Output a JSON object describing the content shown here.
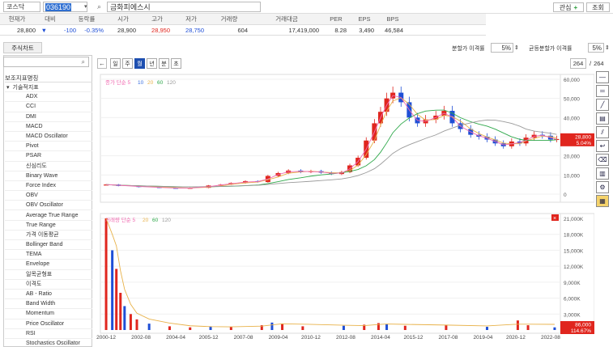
{
  "header": {
    "market": "코스닥",
    "code": "036190",
    "name": "금화피에스시",
    "interest": "관심",
    "query": "조회"
  },
  "quote_cols": [
    "현재가",
    "대비",
    "등락률",
    "시가",
    "고가",
    "저가",
    "거래량",
    "거래대금",
    "PER",
    "EPS",
    "BPS"
  ],
  "quote": {
    "price": "28,800",
    "arrow": "▼",
    "change": "-100",
    "rate": "-0.35%",
    "open": "28,900",
    "high": "28,950",
    "low": "28,750",
    "volume": "604",
    "amount": "17,419,000",
    "per": "8.28",
    "eps": "3,490",
    "bps": "46,584"
  },
  "tab": "주식차트",
  "split": {
    "label1": "분할가 이격률",
    "val1": "5%",
    "label2": "균등분할가 이격률",
    "val2": "5%"
  },
  "periods": [
    "일",
    "주",
    "월",
    "년",
    "분",
    "초"
  ],
  "active_period": "월",
  "count": {
    "shown": "264",
    "total": "264"
  },
  "left": {
    "title": "보조지표명칭",
    "group": "기술적지표",
    "items": [
      "ADX",
      "CCI",
      "DMI",
      "MACD",
      "MACD Oscillator",
      "Pivot",
      "PSAR",
      "신심리도",
      "Binary Wave",
      "Force Index",
      "OBV",
      "OBV Oscillator",
      "Average True Range",
      "True Range",
      "가격 이동평균",
      "Bollinger Band",
      "TEMA",
      "Envelope",
      "일목균형표",
      "이격도",
      "AB - Ratio",
      "Band Width",
      "Momentum",
      "Price Oscillator",
      "RSI",
      "Stochastics Oscillator"
    ]
  },
  "legend_price": {
    "label": "종가 단순",
    "p1": "5",
    "p2": "10",
    "p3": "20",
    "p4": "60",
    "p5": "120"
  },
  "legend_vol": {
    "label": "거래량 단순",
    "p1": "5",
    "p2": "20",
    "p3": "60",
    "p4": "120"
  },
  "price_badge": {
    "v": "28,800",
    "p": "5.04%"
  },
  "vol_badge": {
    "v": "86,000",
    "p": "114.67%"
  },
  "colors": {
    "ma5": "#f06ab0",
    "ma10": "#3a6fe0",
    "ma20": "#e8b24a",
    "ma60": "#2ea84a",
    "ma120": "#9a9a9a",
    "up": "#e0261e",
    "down": "#1f4fd6",
    "badge": "#e0261e"
  },
  "chart_data": [
    {
      "type": "candlestick",
      "title": "",
      "ylim": [
        0,
        60000
      ],
      "y_ticks": [
        "60,000",
        "50,000",
        "40,000",
        "30,000",
        "20,000",
        "10,000",
        "0"
      ],
      "x_ticks": [
        "2000-12",
        "2002-08",
        "2004-04",
        "2005-12",
        "2007-08",
        "2009-04",
        "2010-12",
        "2012-08",
        "2014-04",
        "2015-12",
        "2017-08",
        "2019-04",
        "2020-12",
        "2022-08"
      ],
      "x": [
        2000.9,
        2001.5,
        2002.5,
        2003.5,
        2004.3,
        2005.0,
        2005.9,
        2006.5,
        2007.0,
        2007.7,
        2008.3,
        2008.8,
        2009.3,
        2009.8,
        2010.4,
        2010.9,
        2011.4,
        2011.9,
        2012.4,
        2012.8,
        2013.2,
        2013.6,
        2014.0,
        2014.3,
        2014.6,
        2014.9,
        2015.3,
        2015.7,
        2016.1,
        2016.5,
        2017.0,
        2017.4,
        2017.8,
        2018.2,
        2018.7,
        2019.1,
        2019.5,
        2019.9,
        2020.3,
        2020.7,
        2021.1,
        2021.4,
        2021.8,
        2022.2,
        2022.6,
        2022.9
      ],
      "close": [
        5000,
        4300,
        3700,
        3300,
        3000,
        3300,
        4500,
        5000,
        5800,
        6800,
        6300,
        9500,
        11000,
        12300,
        11500,
        12000,
        11200,
        10500,
        11500,
        15000,
        19000,
        28000,
        37000,
        43000,
        50000,
        53000,
        48000,
        40000,
        37000,
        39000,
        41000,
        43500,
        37000,
        34000,
        31000,
        30000,
        28500,
        26500,
        25000,
        27500,
        26500,
        29500,
        31000,
        30500,
        28500,
        28800
      ]
    },
    {
      "type": "bar",
      "title": "",
      "ylim": [
        0,
        21000000
      ],
      "y_ticks": [
        "21,000K",
        "18,000K",
        "15,000K",
        "12,000K",
        "9,000K",
        "6,000K",
        "3,000K"
      ],
      "x": [
        2000.9,
        2001.2,
        2001.4,
        2001.6,
        2001.8,
        2002.1,
        2002.4,
        2003.0,
        2004.0,
        2005.0,
        2006.0,
        2007.0,
        2008.5,
        2009.0,
        2009.5,
        2010.5,
        2012.5,
        2013.5,
        2014.2,
        2014.6,
        2015.5,
        2017.5,
        2019.5,
        2021.0,
        2021.5,
        2022.8
      ],
      "values": [
        21000000,
        15000000,
        11500000,
        7000000,
        4500000,
        3000000,
        2000000,
        1200000,
        700000,
        500000,
        700000,
        600000,
        900000,
        1400000,
        1200000,
        700000,
        800000,
        1000000,
        1300000,
        1100000,
        800000,
        900000,
        600000,
        1800000,
        900000,
        500000
      ]
    }
  ]
}
